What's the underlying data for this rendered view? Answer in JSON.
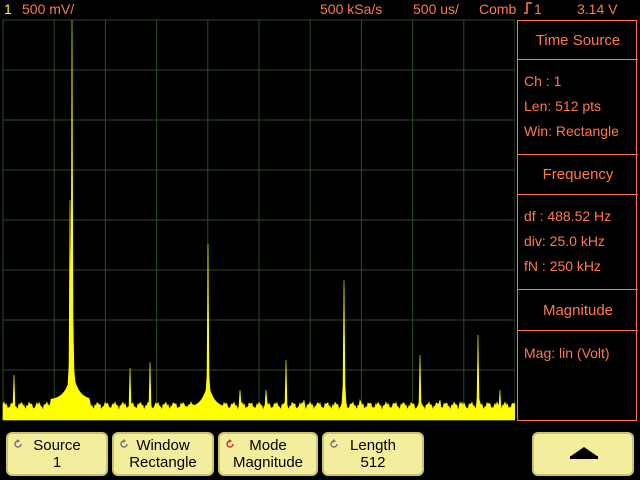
{
  "status": {
    "channel": "1",
    "scale": "500 mV/",
    "sample_rate": "500 kSa/s",
    "timebase": "500 us/",
    "trigger_mode": "Comb",
    "trigger_channel": "1",
    "trigger_level": "3.14 V"
  },
  "panel": {
    "time_source_title": "Time Source",
    "ch_line": "Ch :  1",
    "len_line": "Len:  512   pts",
    "win_line": "Win: Rectangle",
    "frequency_title": "Frequency",
    "df_line": "df : 488.52  Hz",
    "div_line": "div:  25.0 kHz",
    "fn_line": "fN : 250 kHz",
    "magnitude_title": "Magnitude",
    "mag_line": "Mag: lin (Volt)"
  },
  "softkeys": [
    {
      "label": "Source",
      "value": "1",
      "knob": "gray"
    },
    {
      "label": "Window",
      "value": "Rectangle",
      "knob": "gray"
    },
    {
      "label": "Mode",
      "value": "Magnitude",
      "knob": "red"
    },
    {
      "label": "Length",
      "value": "512",
      "knob": "gray"
    }
  ],
  "colors": {
    "text": "#ff7a4a",
    "trace": "#ffff00",
    "grid": "#2c4a2c",
    "softkey": "#f2ee9e"
  },
  "icons": {
    "trigger": "rising-edge-icon",
    "up_arrow": "up-arrow-icon"
  }
}
